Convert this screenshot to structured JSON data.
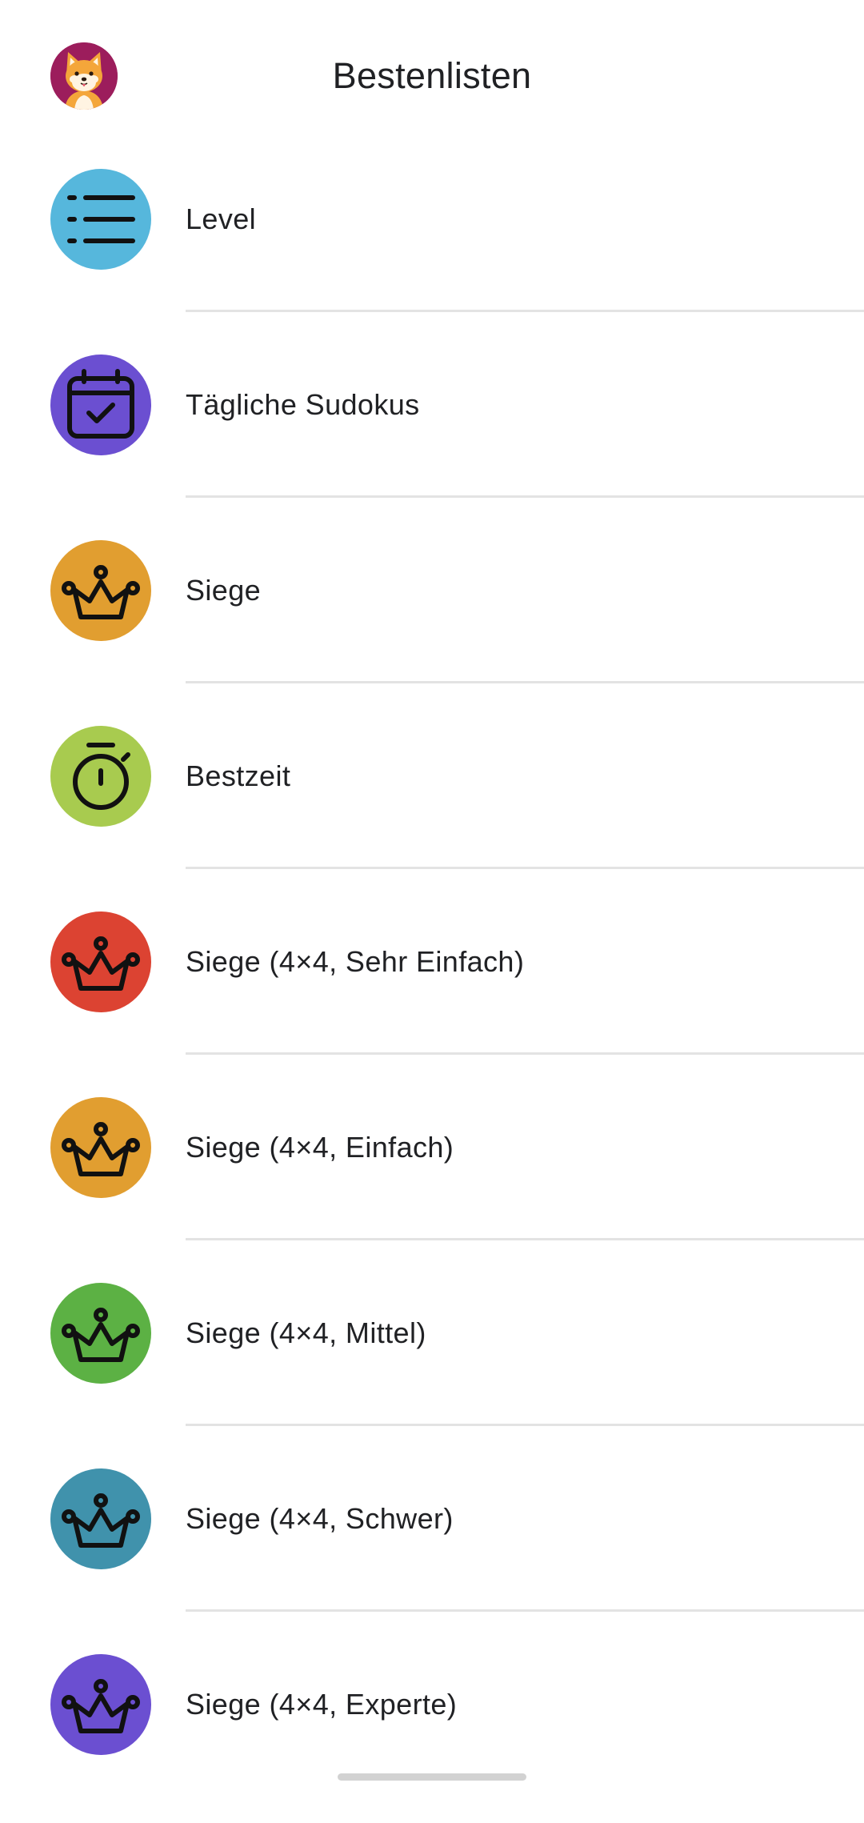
{
  "header": {
    "title": "Bestenlisten",
    "avatar_icon": "shiba-dog-avatar-icon"
  },
  "leaderboards": [
    {
      "label": "Level",
      "icon": "list-icon",
      "color": "#56b7dc"
    },
    {
      "label": "Tägliche Sudokus",
      "icon": "calendar-check-icon",
      "color": "#6b4fd1"
    },
    {
      "label": "Siege",
      "icon": "crown-icon",
      "color": "#e19e30"
    },
    {
      "label": "Bestzeit",
      "icon": "stopwatch-icon",
      "color": "#a8cb4f"
    },
    {
      "label": "Siege (4×4, Sehr Einfach)",
      "icon": "crown-icon",
      "color": "#dc4332"
    },
    {
      "label": "Siege (4×4, Einfach)",
      "icon": "crown-icon",
      "color": "#e19e30"
    },
    {
      "label": "Siege (4×4, Mittel)",
      "icon": "crown-icon",
      "color": "#5cb144"
    },
    {
      "label": "Siege (4×4, Schwer)",
      "icon": "crown-icon",
      "color": "#4092ac"
    },
    {
      "label": "Siege (4×4, Experte)",
      "icon": "crown-icon",
      "color": "#6b4fd1"
    }
  ]
}
